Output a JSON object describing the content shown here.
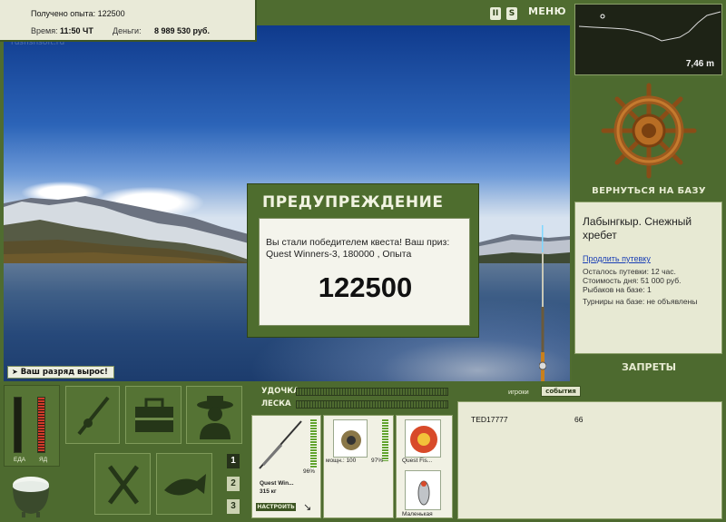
{
  "top_info": {
    "experience_label": "Получено опыта: 122500",
    "time_label": "Время:",
    "time_value": "11:50 ЧТ",
    "money_label": "Деньги:",
    "money_value": "8 989 530 руб."
  },
  "watermark": "rusfishsoft.ru",
  "top_buttons": {
    "pause": "II",
    "sound": "S",
    "menu": "МЕНЮ"
  },
  "depth": {
    "value": "7,46 m"
  },
  "right_panel": {
    "return_label": "ВЕРНУТЬСЯ НА БАЗУ",
    "base_title": "Лабынгкыр. Снежный хребет",
    "extend_link": "Продлить путевку",
    "lines": [
      "Осталось путевки: 12 час.",
      "Стоимость дня: 51 000 руб.",
      "Рыбаков на базе: 1",
      "Турниры на базе: не объявлены"
    ],
    "bans_label": "ЗАПРЕТЫ"
  },
  "rank_message": "Ваш разряд вырос!",
  "dialog": {
    "title": "ПРЕДУПРЕЖДЕНИЕ",
    "message": "Вы стали победителем квеста! Ваш приз: Quest Winners-3, 180000 , Опыта",
    "number": "122500"
  },
  "meters": {
    "food_label": "ЕДА",
    "poison_label": "ЯД"
  },
  "slots": [
    "1",
    "2",
    "3"
  ],
  "tackle": {
    "rod_label": "УДОЧКА",
    "line_label": "ЛЕСКА",
    "rod_percent": "96%",
    "rod_name": "Quest Win...",
    "rod_weight": "315 кг",
    "setup_button": "НАСТРОИТЬ",
    "reel_power": "мощн.: 100",
    "reel_percent": "97%",
    "line_name": "Quest Fis...",
    "lure_name": "Маленькая"
  },
  "players": {
    "tab_players": "игроки",
    "tab_events": "события",
    "rows": [
      {
        "name": "TED17777",
        "value": "66"
      }
    ]
  },
  "colors": {
    "panel_green": "#4d6a2f",
    "paper": "#e9ead6",
    "link_blue": "#1a3fb5"
  }
}
